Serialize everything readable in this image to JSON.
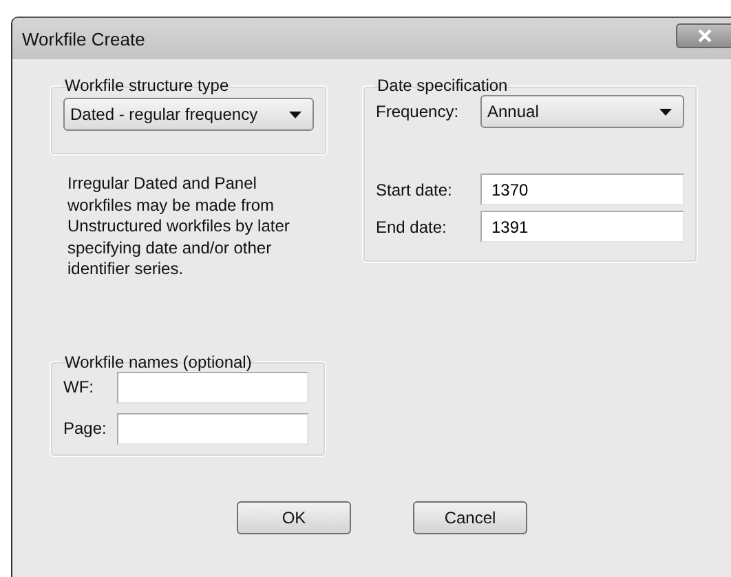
{
  "window": {
    "title": "Workfile Create"
  },
  "structure": {
    "legend": "Workfile structure type",
    "type": "Dated - regular frequency"
  },
  "note": "Irregular Dated and Panel workfiles may be made from Unstructured workfiles by later specifying date and/or other identifier series.",
  "names": {
    "legend": "Workfile names (optional)",
    "fields": [
      {
        "label": "WF:"
      },
      {
        "label": "Page:"
      }
    ]
  },
  "date": {
    "legend": "Date specification",
    "frequency_label": "Frequency:",
    "frequency": "Annual",
    "fields": [
      {
        "label": "Start date:",
        "value": "1370"
      },
      {
        "label": "End date:",
        "value": "1391"
      }
    ]
  },
  "buttons": [
    "OK",
    "Cancel"
  ]
}
